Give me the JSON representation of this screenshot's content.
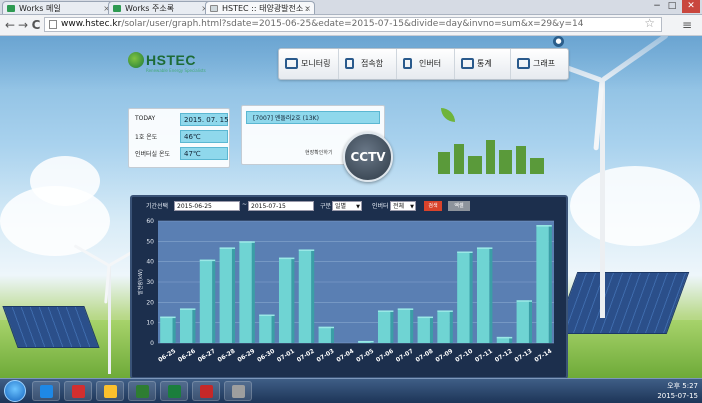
{
  "browser": {
    "tabs": [
      {
        "label": "Works 메일",
        "active": false
      },
      {
        "label": "Works 주소록",
        "active": false
      },
      {
        "label": "HSTEC :: 태양광발전소 :",
        "active": true
      }
    ],
    "url_host": "www.hstec.kr",
    "url_rest": "/solar/user/graph.html?sdate=2015-06-25&edate=2015-07-15&divide=day&invno=sum&x=29&y=14",
    "controls": {
      "back": "←",
      "forward": "→",
      "reload": "C",
      "star": "☆",
      "menu": "≡",
      "minimize": "−",
      "maximize": "□",
      "close": "✕",
      "tab_close": "×"
    }
  },
  "site": {
    "logo": "HSTEC",
    "logo_sub": "Renewable Energy Specialists",
    "nav": [
      {
        "label": "모니터링",
        "icon": "monitor-icon"
      },
      {
        "label": "접속함",
        "icon": "junction-box-icon"
      },
      {
        "label": "인버터",
        "icon": "inverter-icon"
      },
      {
        "label": "통계",
        "icon": "statistics-icon"
      },
      {
        "label": "그래프",
        "icon": "bar-graph-icon"
      }
    ],
    "info": [
      {
        "label": "TODAY",
        "value": "2015. 07. 15"
      },
      {
        "label": "1호 온도",
        "value": "46℃"
      },
      {
        "label": "인버터실 온도",
        "value": "47℃"
      }
    ],
    "site_name": "[7007] 엔돌러2호 (13K)",
    "site_link": "현장확인하기",
    "cctv": "CCTV"
  },
  "controls": {
    "period_label": "기간선택",
    "start_date": "2015-06-25",
    "separator": "~",
    "end_date": "2015-07-15",
    "divide_label": "구분",
    "divide_value": "일별",
    "inverter_label": "인버터",
    "inverter_value": "전체",
    "search_button": "검색",
    "excel_button": "엑셀",
    "dropdown_arrow": "▼"
  },
  "chart_data": {
    "type": "bar",
    "ylabel": "발전량(kW)",
    "ylim": [
      0,
      60
    ],
    "yticks": [
      0,
      10,
      20,
      30,
      40,
      50,
      60
    ],
    "categories": [
      "06-25",
      "06-26",
      "06-27",
      "06-28",
      "06-29",
      "06-30",
      "07-01",
      "07-02",
      "07-03",
      "07-04",
      "07-05",
      "07-06",
      "07-07",
      "07-08",
      "07-09",
      "07-10",
      "07-11",
      "07-12",
      "07-13",
      "07-14"
    ],
    "values": [
      13,
      17,
      41,
      47,
      50,
      14,
      42,
      46,
      8,
      0,
      1,
      16,
      17,
      13,
      16,
      45,
      47,
      3,
      21,
      58
    ],
    "bar_color": "#6fd4d3",
    "bar_side_color": "#3a9fa6",
    "plot_bg": "#5a7fb3",
    "grid": true
  },
  "taskbar": {
    "clock_time": "오후 5:27",
    "clock_date": "2015-07-15",
    "apps": [
      {
        "icon": "ie-icon",
        "color": "#1e88e5"
      },
      {
        "icon": "app-red-icon",
        "color": "#d32f2f"
      },
      {
        "icon": "chrome-icon",
        "color": "#fbc02d"
      },
      {
        "icon": "app-green-icon",
        "color": "#2e7d32"
      },
      {
        "icon": "excel-icon",
        "color": "#1b7e3c"
      },
      {
        "icon": "pdf-icon",
        "color": "#c62828"
      },
      {
        "icon": "app-misc-icon",
        "color": "#9e9e9e"
      }
    ]
  }
}
